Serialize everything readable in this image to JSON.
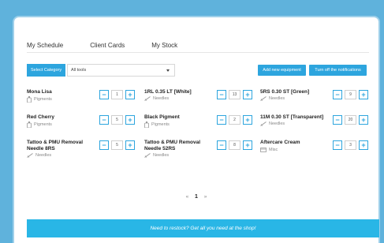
{
  "tabs": [
    {
      "label": "My Schedule"
    },
    {
      "label": "Client Cards"
    },
    {
      "label": "My Stock"
    }
  ],
  "filter": {
    "label": "Select Category",
    "value": "All tools"
  },
  "actions": {
    "add": "Add new equipment",
    "notifications": "Turn off the notifications"
  },
  "items": [
    {
      "name": "Mona Lisa",
      "category": "Pigments",
      "qty": "1"
    },
    {
      "name": "1RL 0.35 LT [White]",
      "category": "Needles",
      "qty": "13"
    },
    {
      "name": "5RS 0.30 ST [Green]",
      "category": "Needles",
      "qty": "9"
    },
    {
      "name": "Red Cherry",
      "category": "Pigments",
      "qty": "5"
    },
    {
      "name": "Black Pigment",
      "category": "Pigments",
      "qty": "2"
    },
    {
      "name": "11M 0.30 ST [Transparent]",
      "category": "Needles",
      "qty": "20"
    },
    {
      "name": "Tattoo & PMU Removal Needle 8RS",
      "category": "Needles",
      "qty": "5"
    },
    {
      "name": "Tattoo & PMU Removal Needle 52RS",
      "category": "Needles",
      "qty": "8"
    },
    {
      "name": "Aftercare Cream",
      "category": "Misc",
      "qty": "3"
    }
  ],
  "pagination": {
    "prev": "«",
    "current": "1",
    "next": "»"
  },
  "promo": {
    "text": "Need to restock?   Get all you need at the shop!"
  }
}
